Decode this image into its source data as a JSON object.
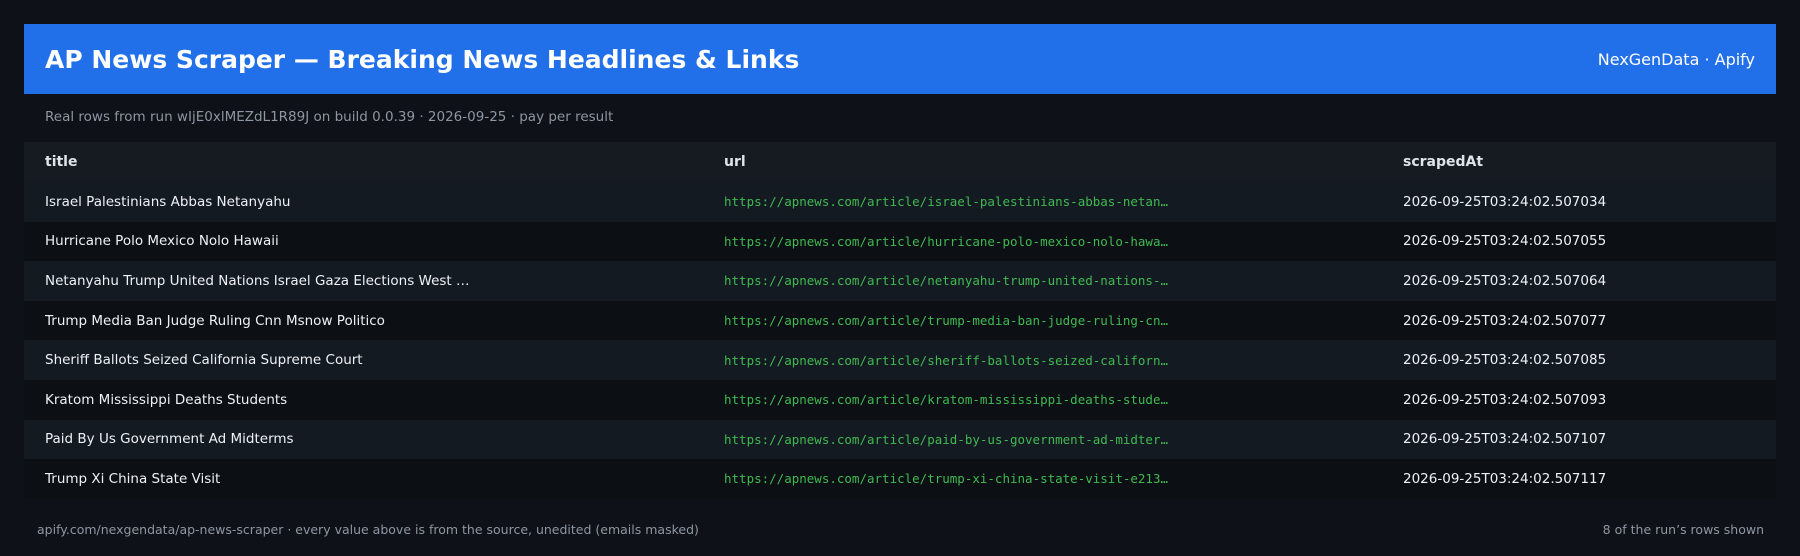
{
  "header": {
    "title": "AP News Scraper — Breaking News Headlines & Links",
    "brand": "NexGenData · Apify"
  },
  "subtitle": "Real rows from run wIjE0xlMEZdL1R89J on build 0.0.39 · 2026-09-25 · pay per result",
  "table": {
    "columns": [
      "title",
      "url",
      "scrapedAt"
    ],
    "rows": [
      {
        "title": "Israel Palestinians Abbas Netanyahu",
        "url": "https://apnews.com/article/israel-palestinians-abbas-netan…",
        "scrapedAt": "2026-09-25T03:24:02.507034"
      },
      {
        "title": "Hurricane Polo Mexico Nolo Hawaii",
        "url": "https://apnews.com/article/hurricane-polo-mexico-nolo-hawa…",
        "scrapedAt": "2026-09-25T03:24:02.507055"
      },
      {
        "title": "Netanyahu Trump United Nations Israel Gaza Elections West …",
        "url": "https://apnews.com/article/netanyahu-trump-united-nations-…",
        "scrapedAt": "2026-09-25T03:24:02.507064"
      },
      {
        "title": "Trump Media Ban Judge Ruling Cnn Msnow Politico",
        "url": "https://apnews.com/article/trump-media-ban-judge-ruling-cn…",
        "scrapedAt": "2026-09-25T03:24:02.507077"
      },
      {
        "title": "Sheriff Ballots Seized California Supreme Court",
        "url": "https://apnews.com/article/sheriff-ballots-seized-californ…",
        "scrapedAt": "2026-09-25T03:24:02.507085"
      },
      {
        "title": "Kratom Mississippi Deaths Students",
        "url": "https://apnews.com/article/kratom-mississippi-deaths-stude…",
        "scrapedAt": "2026-09-25T03:24:02.507093"
      },
      {
        "title": "Paid By Us Government Ad Midterms",
        "url": "https://apnews.com/article/paid-by-us-government-ad-midter…",
        "scrapedAt": "2026-09-25T03:24:02.507107"
      },
      {
        "title": "Trump Xi China State Visit",
        "url": "https://apnews.com/article/trump-xi-china-state-visit-e213…",
        "scrapedAt": "2026-09-25T03:24:02.507117"
      }
    ]
  },
  "footer": {
    "source": "apify.com/nexgendata/ap-news-scraper  ·  every value above is from the source, unedited (emails masked)",
    "count": "8 of the run’s rows shown"
  },
  "colors": {
    "background": "#0e1117",
    "header_bg": "#2170ea",
    "url_text": "#3fb950",
    "muted_text": "#8e96a3"
  }
}
